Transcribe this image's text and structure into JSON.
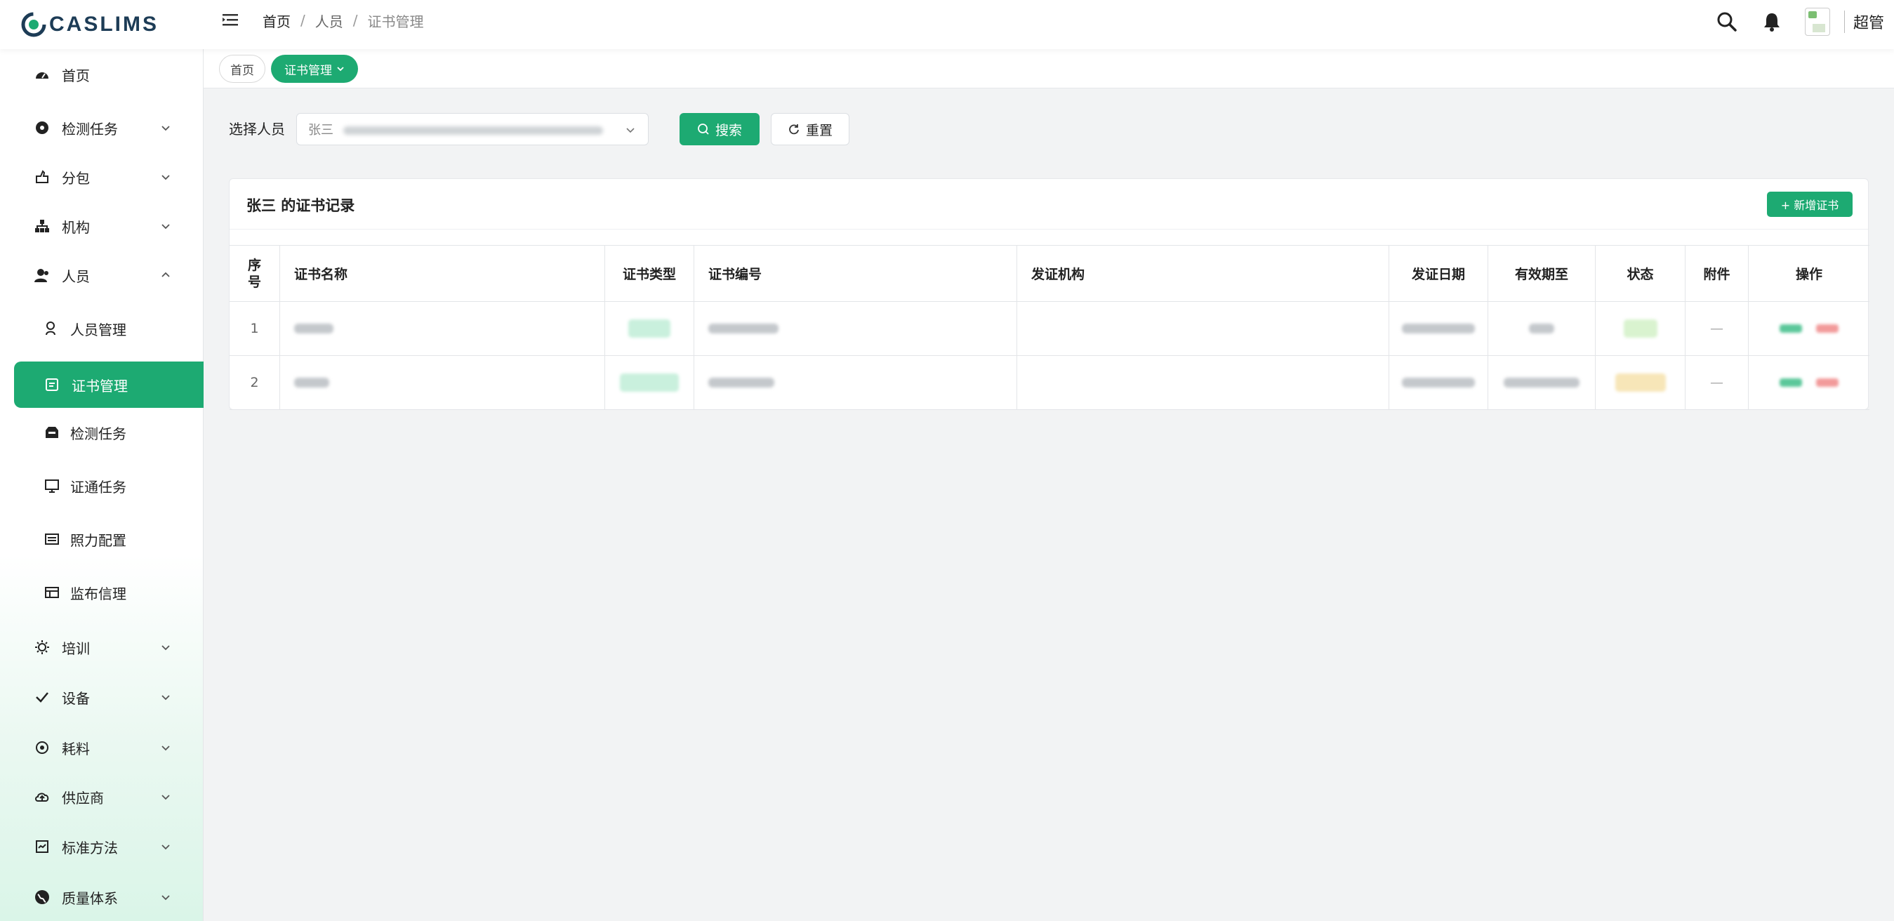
{
  "app": {
    "logo_text": "CASLIMS"
  },
  "breadcrumb": {
    "home": "首页",
    "sep1": "/",
    "section": "人员",
    "sep2": "/",
    "current": "证书管理"
  },
  "user": {
    "name": "超管"
  },
  "sidebar": {
    "items": [
      {
        "label": "首页",
        "icon": "dashboard-icon"
      },
      {
        "label": "检测任务",
        "icon": "task-icon",
        "expandable": true
      },
      {
        "label": "分包",
        "icon": "package-icon",
        "expandable": true
      },
      {
        "label": "机构",
        "icon": "organization-icon",
        "expandable": true
      },
      {
        "label": "人员",
        "icon": "person-icon",
        "expandable": true,
        "expanded": true
      },
      {
        "label": "人员管理",
        "icon": "person-manage-icon",
        "sub": true
      },
      {
        "label": "证书管理",
        "icon": "certificate-icon",
        "sub": true,
        "active": true
      },
      {
        "label": "检测任务",
        "icon": "inbox-icon",
        "sub": true
      },
      {
        "label": "证通任务",
        "icon": "monitor-icon",
        "sub": true
      },
      {
        "label": "照力配置",
        "icon": "config-icon",
        "sub": true
      },
      {
        "label": "监布信理",
        "icon": "list-icon",
        "sub": true
      },
      {
        "label": "培训",
        "icon": "gear-icon",
        "expandable": true
      },
      {
        "label": "设备",
        "icon": "check-icon",
        "expandable": true
      },
      {
        "label": "耗料",
        "icon": "material-icon",
        "expandable": true
      },
      {
        "label": "供应商",
        "icon": "cloud-icon",
        "expandable": true
      },
      {
        "label": "标准方法",
        "icon": "chart-icon",
        "expandable": true
      },
      {
        "label": "质量体系",
        "icon": "globe-icon",
        "expandable": true
      }
    ]
  },
  "tags": {
    "home": "首页",
    "current": "证书管理"
  },
  "search": {
    "label": "选择人员",
    "selected_prefix": "张三",
    "search_button": "搜索",
    "reset_button": "重置"
  },
  "card": {
    "title": "张三 的证书记录",
    "add_button": "+ 新增证书"
  },
  "table": {
    "headers": [
      "序号",
      "证书名称",
      "证书类型",
      "证书编号",
      "发证机构",
      "发证日期",
      "有效期至",
      "状态",
      "附件",
      "操作"
    ],
    "rows": [
      {
        "index": "1",
        "attachment": "—",
        "type_badge": "green",
        "status_badge": "lime"
      },
      {
        "index": "2",
        "attachment": "—",
        "type_badge": "green",
        "status_badge": "yellow"
      }
    ]
  },
  "colors": {
    "accent": "#1daa72",
    "danger": "#f29a9a",
    "warning": "#f7e6b8"
  }
}
